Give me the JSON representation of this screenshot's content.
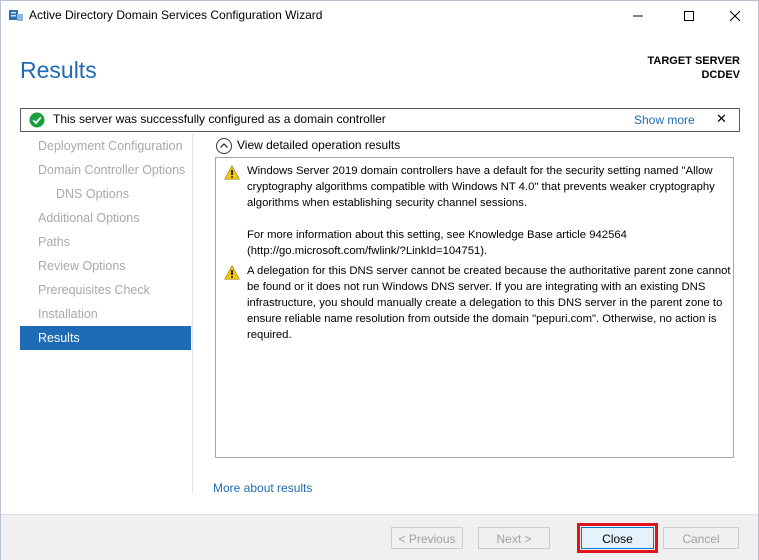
{
  "window": {
    "title": "Active Directory Domain Services Configuration Wizard",
    "controls": {
      "minimize": "—",
      "maximize": "☐",
      "close": "✕"
    }
  },
  "header": {
    "title": "Results",
    "target_label": "TARGET SERVER",
    "target_name": "DCDEV"
  },
  "banner": {
    "message": "This server was successfully configured as a domain controller",
    "show_more": "Show more",
    "dismiss": "✕",
    "status_color": "#1b9e3e"
  },
  "nav": {
    "items": [
      {
        "label": "Deployment Configuration"
      },
      {
        "label": "Domain Controller Options"
      },
      {
        "label": "DNS Options"
      },
      {
        "label": "Additional Options"
      },
      {
        "label": "Paths"
      },
      {
        "label": "Review Options"
      },
      {
        "label": "Prerequisites Check"
      },
      {
        "label": "Installation"
      },
      {
        "label": "Results"
      }
    ]
  },
  "details": {
    "toggle_label": "View detailed operation results",
    "entries": [
      {
        "icon": "warning-icon",
        "paragraphs": [
          "Windows Server 2019 domain controllers have a default for the security setting named \"Allow cryptography algorithms compatible with Windows NT 4.0\" that prevents weaker cryptography algorithms when establishing security channel sessions.",
          "For more information about this setting, see Knowledge Base article 942564 (http://go.microsoft.com/fwlink/?LinkId=104751)."
        ]
      },
      {
        "icon": "warning-icon",
        "paragraphs": [
          "A delegation for this DNS server cannot be created because the authoritative parent zone cannot be found or it does not run Windows DNS server. If you are integrating with an existing DNS infrastructure, you should manually create a delegation to this DNS server in the parent zone to ensure reliable name resolution from outside the domain \"pepuri.com\". Otherwise, no action is required."
        ]
      }
    ]
  },
  "links": {
    "more_about_results": "More about results"
  },
  "footer": {
    "previous": "< Previous",
    "next": "Next >",
    "close": "Close",
    "cancel": "Cancel"
  },
  "colors": {
    "accent": "#1e6ab4",
    "highlight_frame": "#e0141e",
    "warning": "#f2c811"
  }
}
